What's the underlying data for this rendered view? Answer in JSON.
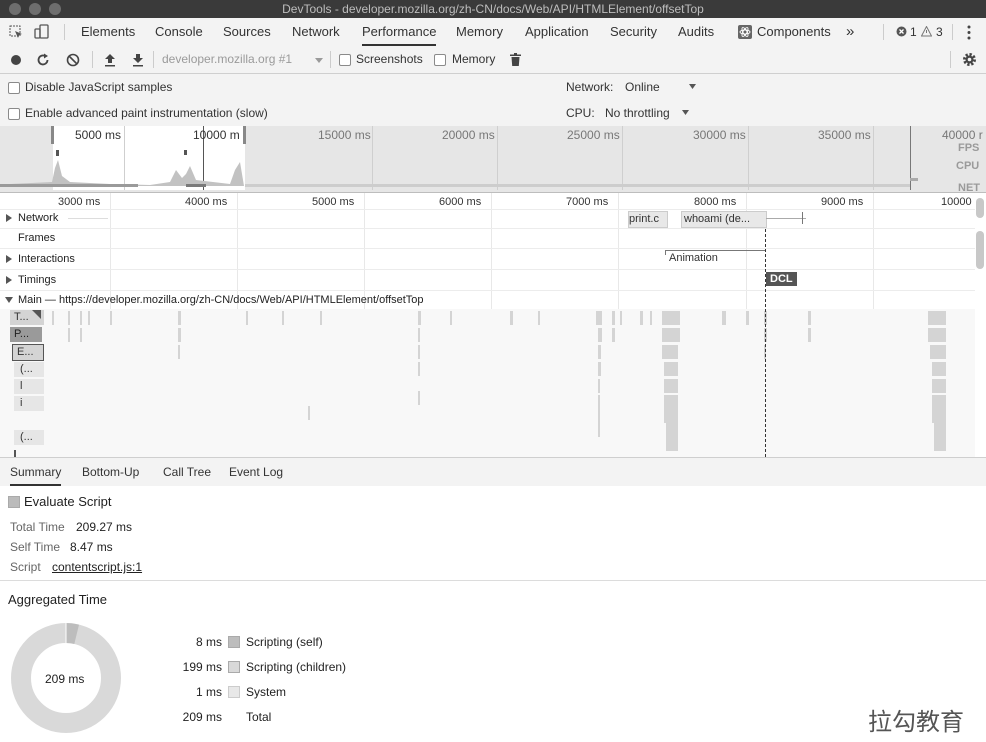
{
  "window": {
    "title": "DevTools - developer.mozilla.org/zh-CN/docs/Web/API/HTMLElement/offsetTop"
  },
  "tabs": [
    "Elements",
    "Console",
    "Sources",
    "Network",
    "Performance",
    "Memory",
    "Application",
    "Security",
    "Audits",
    "Components"
  ],
  "tab_active": "Performance",
  "tab_more": "»",
  "badges": {
    "errors": "1",
    "warnings": "3"
  },
  "toolbar": {
    "profile_select": "developer.mozilla.org #1",
    "screenshots_label": "Screenshots",
    "memory_label": "Memory"
  },
  "settings": {
    "disable_js_samples": "Disable JavaScript samples",
    "advanced_paint": "Enable advanced paint instrumentation (slow)",
    "network_label": "Network:",
    "network_value": "Online",
    "cpu_label": "CPU:",
    "cpu_value": "No throttling"
  },
  "overview": {
    "ticks": [
      "5000 ms",
      "10000 m",
      "15000 ms",
      "20000 ms",
      "25000 ms",
      "30000 ms",
      "35000 ms",
      "40000 r"
    ],
    "labels": [
      "FPS",
      "CPU",
      "NET"
    ]
  },
  "ruler": [
    "3000 ms",
    "4000 ms",
    "5000 ms",
    "6000 ms",
    "7000 ms",
    "8000 ms",
    "9000 ms",
    "10000"
  ],
  "tracks": {
    "network": "Network",
    "frames": "Frames",
    "interactions": "Interactions",
    "timings": "Timings",
    "main": "Main — https://developer.mozilla.org/zh-CN/docs/Web/API/HTMLElement/offsetTop"
  },
  "network_items": [
    "print.c",
    "whoami (de..."
  ],
  "animation_label": "Animation",
  "dcl_label": "DCL",
  "main_labels": [
    "T...",
    "P...",
    "E...",
    "(...",
    "l",
    "i",
    "(..."
  ],
  "bottom_tabs": [
    "Summary",
    "Bottom-Up",
    "Call Tree",
    "Event Log"
  ],
  "bottom_tab_active": "Summary",
  "summary": {
    "title": "Evaluate Script",
    "total_time_label": "Total Time",
    "total_time": "209.27 ms",
    "self_time_label": "Self Time",
    "self_time": "8.47 ms",
    "script_label": "Script",
    "script_link": "contentscript.js:1",
    "aggregated_title": "Aggregated Time",
    "donut_center": "209 ms",
    "rows": [
      {
        "value": "8 ms",
        "label": "Scripting (self)"
      },
      {
        "value": "199 ms",
        "label": "Scripting (children)"
      },
      {
        "value": "1 ms",
        "label": "System"
      },
      {
        "value": "209 ms",
        "label": "Total"
      }
    ]
  },
  "watermark": "拉勾教育"
}
